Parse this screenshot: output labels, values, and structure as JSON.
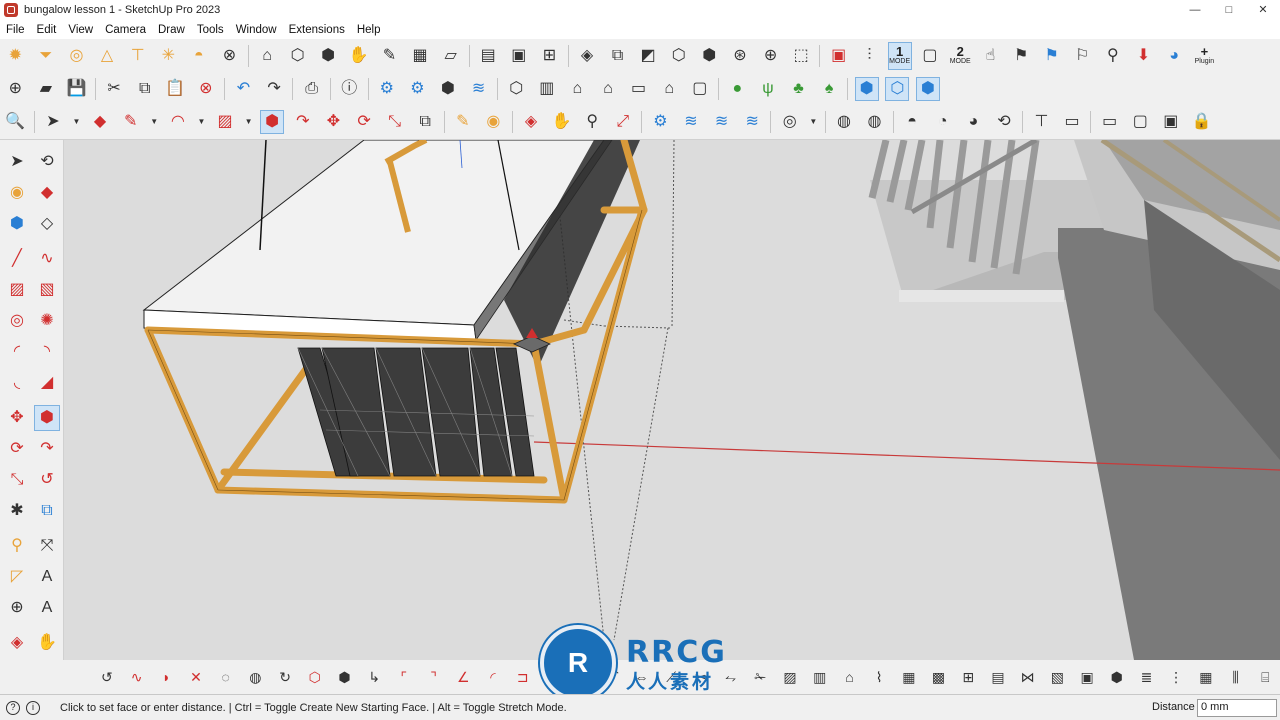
{
  "window": {
    "title": "bungalow lesson 1 - SketchUp Pro 2023",
    "controls": [
      "—",
      "□",
      "✕"
    ]
  },
  "menu": [
    "File",
    "Edit",
    "View",
    "Camera",
    "Draw",
    "Tools",
    "Window",
    "Extensions",
    "Help"
  ],
  "toolbar": {
    "mode1_number": "1",
    "mode1_label": "MODE",
    "mode2_number": "2",
    "mode2_label": "MODE",
    "plugin_label": "Plugin"
  },
  "statusbar": {
    "hint": "Click to set face or enter distance.  |  Ctrl = Toggle Create New Starting Face.  |  Alt = Toggle Stretch Mode.",
    "measure_label": "Distance",
    "measure_value": "0 mm"
  },
  "watermark": {
    "logo_text": "RRCG",
    "subtitle": "人人素材",
    "badge": "R"
  },
  "colors": {
    "frame_wood": "#d89a3a",
    "axis_red": "#c83a3a",
    "viewport_bg": "#dcdcdc",
    "accent_blue": "#2a7fd4"
  }
}
